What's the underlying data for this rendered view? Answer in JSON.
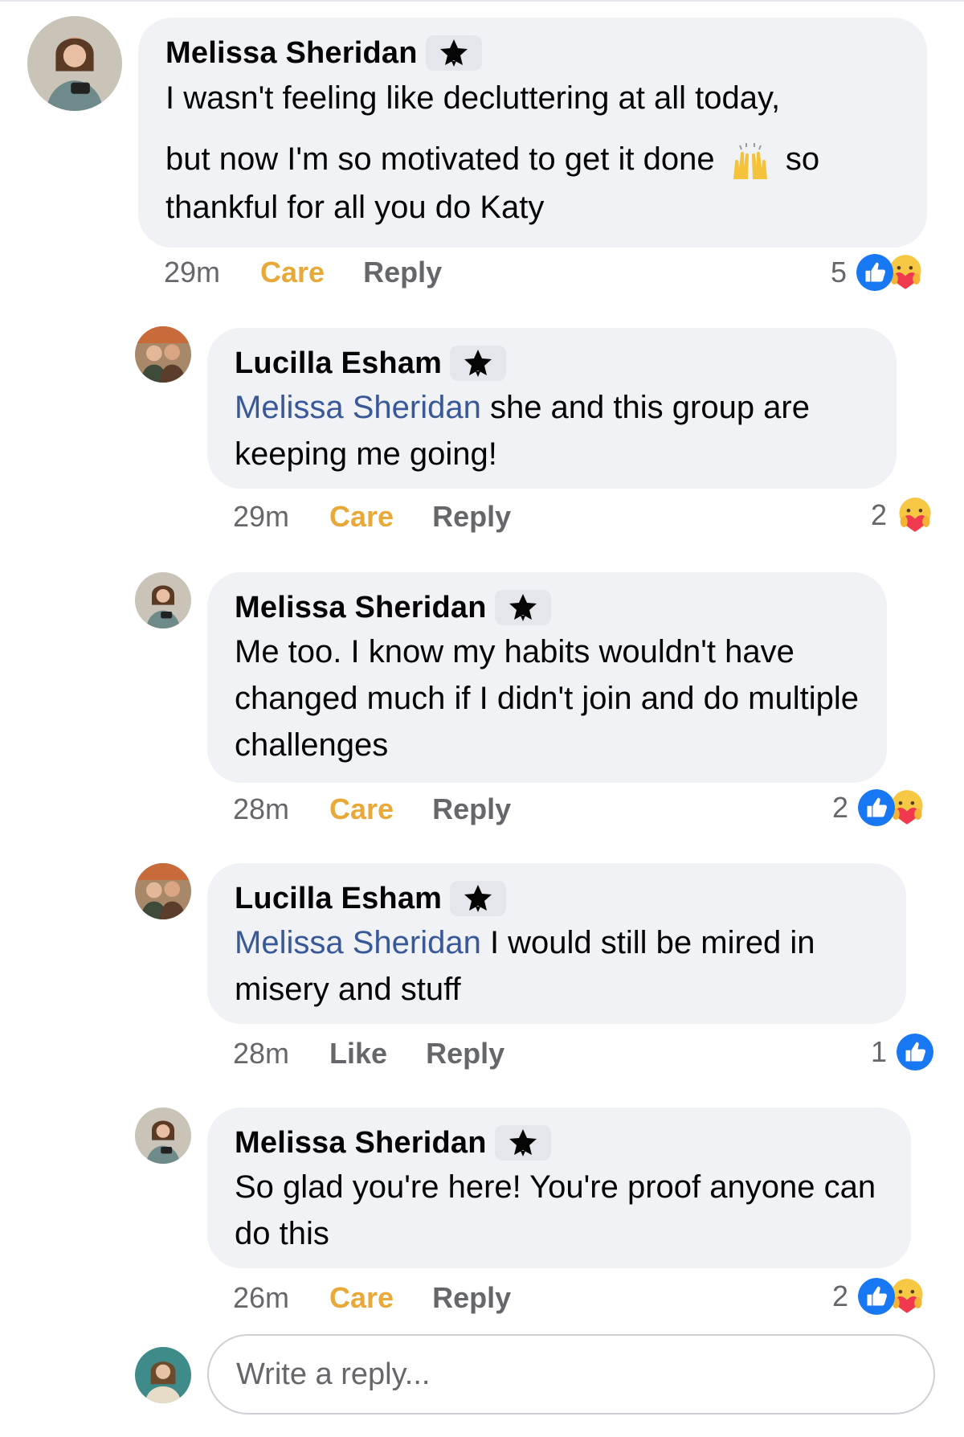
{
  "comments": [
    {
      "author": "Melissa Sheridan",
      "mention": "",
      "text_part1": "I wasn't feeling like decluttering at all today,",
      "text_part2": "but now I'm so motivated to get it done",
      "text_part3": "so",
      "text_part4": "thankful for all you do Katy",
      "time": "29m",
      "react_label": "Care",
      "reply_label": "Reply",
      "reaction_count": "5",
      "reactions": [
        "like-icon",
        "care-icon"
      ]
    },
    {
      "author": "Lucilla Esham",
      "mention": "Melissa Sheridan",
      "text": " she and this group are keeping me going!",
      "time": "29m",
      "react_label": "Care",
      "reply_label": "Reply",
      "reaction_count": "2",
      "reactions": [
        "care-icon"
      ]
    },
    {
      "author": "Melissa Sheridan",
      "mention": "",
      "text": "Me too. I know my habits wouldn't have changed much if I didn't join and do multiple challenges",
      "time": "28m",
      "react_label": "Care",
      "reply_label": "Reply",
      "reaction_count": "2",
      "reactions": [
        "like-icon",
        "care-icon"
      ]
    },
    {
      "author": "Lucilla Esham",
      "mention": "Melissa Sheridan",
      "text": " I would still be mired in misery and stuff",
      "time": "28m",
      "react_label": "Like",
      "reply_label": "Reply",
      "reaction_count": "1",
      "reactions": [
        "like-icon"
      ]
    },
    {
      "author": "Melissa Sheridan",
      "mention": "",
      "text": "So glad you're here! You're proof anyone can do this",
      "time": "26m",
      "react_label": "Care",
      "reply_label": "Reply",
      "reaction_count": "2",
      "reactions": [
        "like-icon",
        "care-icon"
      ]
    }
  ],
  "reply_box": {
    "placeholder": "Write a reply..."
  },
  "colors": {
    "bubble": "#f0f2f5",
    "mention": "#385898",
    "care": "#e8a93a",
    "like_blue": "#1877f2",
    "secondary_text": "#65676b"
  }
}
